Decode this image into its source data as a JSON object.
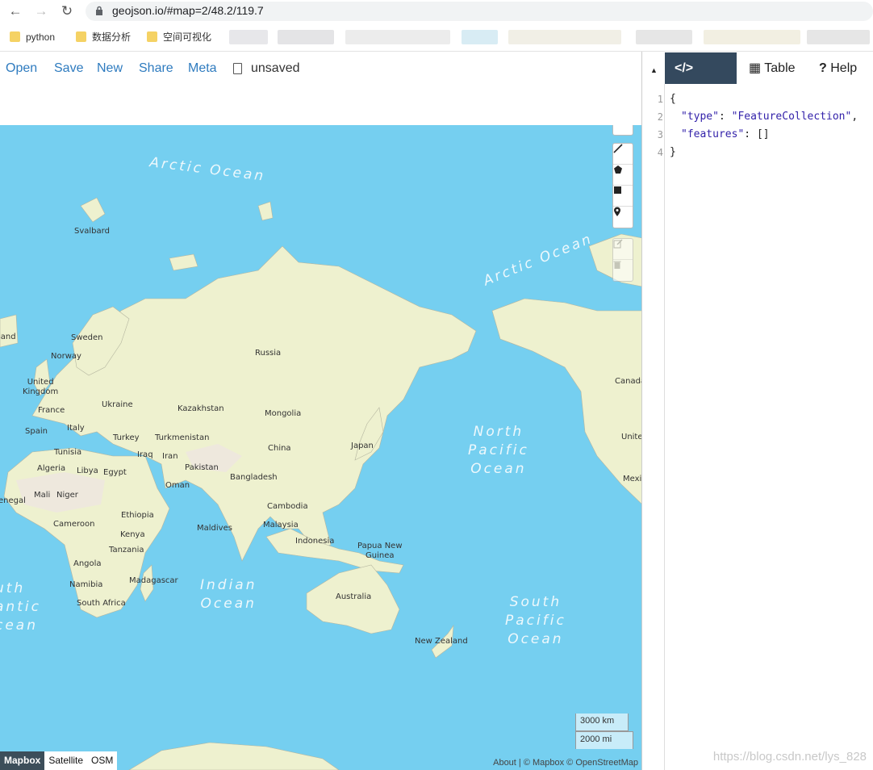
{
  "browser": {
    "url": "geojson.io/#map=2/48.2/119.7",
    "bookmarks": [
      "python",
      "数据分析",
      "空间可视化"
    ]
  },
  "menu": {
    "items": [
      "Open",
      "Save",
      "New",
      "Share",
      "Meta"
    ],
    "file_name": "unsaved"
  },
  "map": {
    "oceans": [
      {
        "id": "arctic-1",
        "text": "Arctic Ocean"
      },
      {
        "id": "arctic-2",
        "text": "Arctic Ocean"
      },
      {
        "id": "north-pacific",
        "text": "North\nPacific\nOcean"
      },
      {
        "id": "indian",
        "text": "Indian\nOcean"
      },
      {
        "id": "south-pacific",
        "text": "South\nPacific\nOcean"
      },
      {
        "id": "south-atlantic",
        "text": "uth\nantic\ncean"
      }
    ],
    "labels": [
      "Svalbard",
      "Sweden",
      "Norway",
      "United\nKingdom",
      "France",
      "Spain",
      "Italy",
      "Ukraine",
      "Kazakhstan",
      "Mongolia",
      "Russia",
      "Turkey",
      "Turkmenistan",
      "China",
      "Japan",
      "Tunisia",
      "Algeria",
      "Libya",
      "Egypt",
      "Iraq",
      "Iran",
      "Pakistan",
      "Bangladesh",
      "Oman",
      "Mali",
      "Niger",
      "enegal",
      "Cameroon",
      "Ethiopia",
      "Kenya",
      "Tanzania",
      "Angola",
      "Namibia",
      "South Africa",
      "Madagascar",
      "Maldives",
      "Malaysia",
      "Cambodia",
      "Indonesia",
      "Papua New\nGuinea",
      "Australia",
      "New Zealand",
      "Canada",
      "Unite",
      "Mexi",
      "land"
    ],
    "scale": {
      "km": "3000 km",
      "mi": "2000 mi"
    },
    "layers": [
      "Mapbox",
      "Satellite",
      "OSM"
    ],
    "attribution": "About | © Mapbox © OpenStreetMap"
  },
  "panel": {
    "tabs": [
      "JSON",
      "Table",
      "Help"
    ],
    "code_lines": [
      "1",
      "2",
      "3",
      "4"
    ],
    "code": {
      "open": "{",
      "type_key": "\"type\"",
      "type_val": "\"FeatureCollection\"",
      "features_key": "\"features\"",
      "features_val": "[]",
      "close": "}"
    }
  },
  "watermark": "https://blog.csdn.net/lys_828"
}
